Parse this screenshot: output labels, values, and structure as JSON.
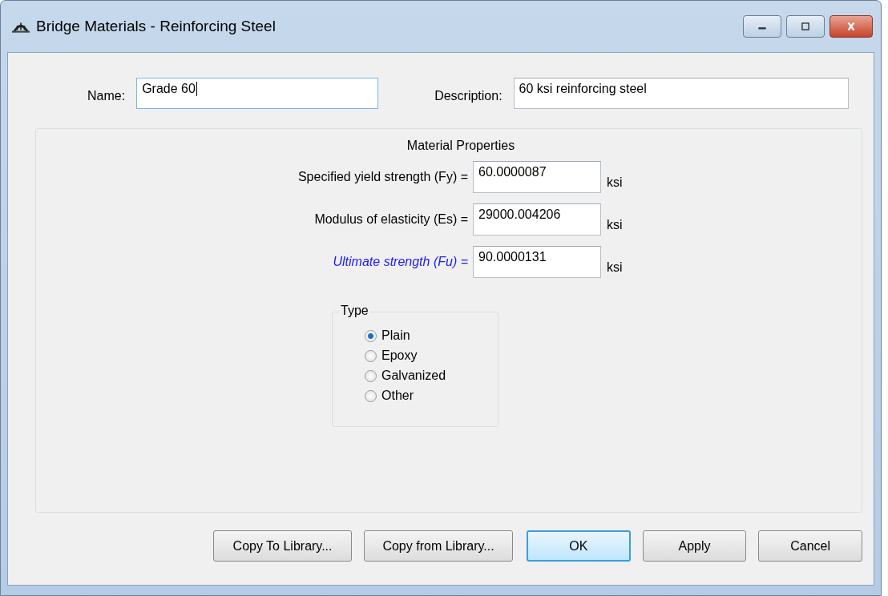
{
  "window": {
    "title": "Bridge Materials - Reinforcing Steel"
  },
  "fields": [
    {
      "label": "Name:",
      "value": "Grade 60",
      "focused": true
    },
    {
      "label": "Description:",
      "value": "60 ksi reinforcing steel",
      "focused": false
    }
  ],
  "properties": {
    "title": "Material Properties",
    "rows": [
      {
        "label": "Specified yield strength (Fy) =",
        "value": "60.0000087",
        "unit": "ksi",
        "kind": "normal"
      },
      {
        "label": "Modulus of elasticity (Es) =",
        "value": "29000.004206",
        "unit": "ksi",
        "kind": "normal"
      },
      {
        "label": "Ultimate strength (Fu) =",
        "value": "90.0000131",
        "unit": "ksi",
        "kind": "optional"
      }
    ]
  },
  "type_group": {
    "title": "Type",
    "options": [
      {
        "label": "Plain",
        "selected": true
      },
      {
        "label": "Epoxy",
        "selected": false
      },
      {
        "label": "Galvanized",
        "selected": false
      },
      {
        "label": "Other",
        "selected": false
      }
    ]
  },
  "buttons": [
    {
      "label": "Copy To Library...",
      "default": false
    },
    {
      "label": "Copy from Library...",
      "default": false
    },
    {
      "label": "OK",
      "default": true
    },
    {
      "label": "Apply",
      "default": false
    },
    {
      "label": "Cancel",
      "default": false
    }
  ]
}
